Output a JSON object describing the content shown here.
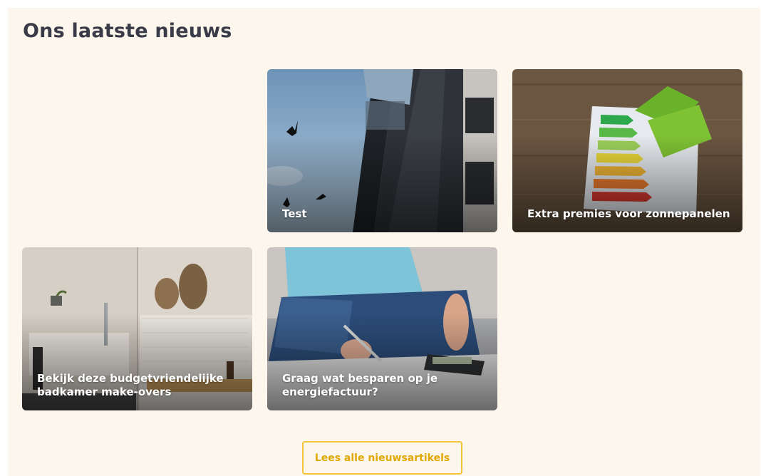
{
  "section": {
    "title": "Ons laatste nieuws"
  },
  "articles": [
    {
      "title": "Test",
      "image": "bird-building-photo"
    },
    {
      "title": "Extra premies voor zonnepanelen",
      "image": "energy-label-house-photo"
    },
    {
      "title": "Bekijk deze budgetvriendelijke badkamer make-overs",
      "image": "bathroom-photo"
    },
    {
      "title": "Graag wat besparen op je energiefactuur?",
      "image": "calculator-photo"
    }
  ],
  "cta": {
    "label": "Lees alle nieuwsartikels"
  },
  "colors": {
    "background": "#fdf6ec",
    "heading": "#3a3b48",
    "accent": "#f3c53b"
  }
}
